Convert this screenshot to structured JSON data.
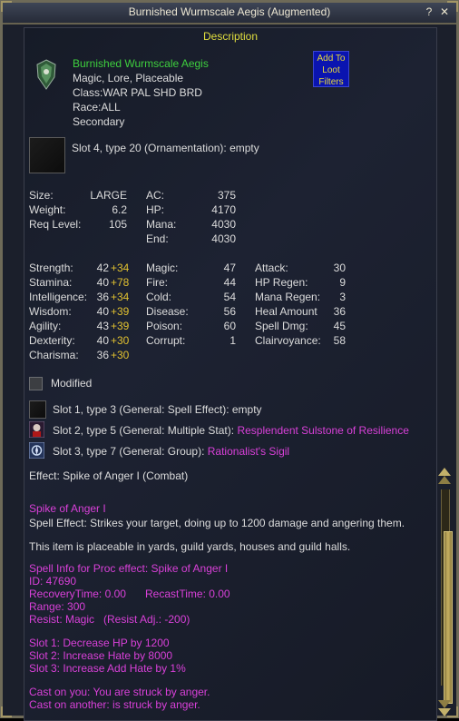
{
  "window": {
    "title": "Burnished Wurmscale Aegis (Augmented)",
    "help_label": "?",
    "close_label": "✕"
  },
  "header": {
    "description_label": "Description",
    "loot_button_label": "Add To\nLoot\nFilters"
  },
  "item": {
    "name": "Burnished Wurmscale Aegis",
    "flags": "Magic, Lore, Placeable",
    "classes": "Class:WAR PAL SHD BRD",
    "races": "Race:ALL",
    "slot": "Secondary",
    "icon": "wurmscale-shield-icon"
  },
  "ornament_slot": "Slot 4, type 20 (Ornamentation): empty",
  "basic_stats": [
    {
      "label": "Size:",
      "value": "LARGE"
    },
    {
      "label": "Weight:",
      "value": "6.2"
    },
    {
      "label": "Req Level:",
      "value": "105"
    }
  ],
  "defense_stats": [
    {
      "label": "AC:",
      "value": "375"
    },
    {
      "label": "HP:",
      "value": "4170"
    },
    {
      "label": "Mana:",
      "value": "4030"
    },
    {
      "label": "End:",
      "value": "4030"
    }
  ],
  "attributes": [
    {
      "label": "Strength:",
      "value": "42",
      "bonus": "+34"
    },
    {
      "label": "Stamina:",
      "value": "40",
      "bonus": "+78"
    },
    {
      "label": "Intelligence:",
      "value": "36",
      "bonus": "+34"
    },
    {
      "label": "Wisdom:",
      "value": "40",
      "bonus": "+39"
    },
    {
      "label": "Agility:",
      "value": "43",
      "bonus": "+39"
    },
    {
      "label": "Dexterity:",
      "value": "40",
      "bonus": "+30"
    },
    {
      "label": "Charisma:",
      "value": "36",
      "bonus": "+30"
    }
  ],
  "resists": [
    {
      "label": "Magic:",
      "value": "47"
    },
    {
      "label": "Fire:",
      "value": "44"
    },
    {
      "label": "Cold:",
      "value": "54"
    },
    {
      "label": "Disease:",
      "value": "56"
    },
    {
      "label": "Poison:",
      "value": "60"
    },
    {
      "label": "Corrupt:",
      "value": "1"
    }
  ],
  "mods": [
    {
      "label": "Attack:",
      "value": "30"
    },
    {
      "label": "HP Regen:",
      "value": "9"
    },
    {
      "label": "Mana Regen:",
      "value": "3"
    },
    {
      "label": "Heal Amount",
      "value": "36"
    },
    {
      "label": "Spell Dmg:",
      "value": "45"
    },
    {
      "label": "Clairvoyance:",
      "value": "58"
    }
  ],
  "modified_label": "Modified",
  "aug_slots": [
    {
      "text": "Slot 1, type 3 (General: Spell Effect): empty",
      "link": "",
      "icon": "empty-slot-icon"
    },
    {
      "text": "Slot 2, type 5 (General: Multiple Stat): ",
      "link": "Resplendent Sulstone of Resilience",
      "icon": "sulstone-icon"
    },
    {
      "text": "Slot 3, type 7 (General: Group): ",
      "link": "Rationalist's Sigil",
      "icon": "sigil-icon"
    }
  ],
  "effect_line": "Effect: Spike of Anger I (Combat)",
  "spell": {
    "name": "Spike of Anger I",
    "effect": "Spell Effect: Strikes your target, doing up to 1200 damage and angering them.",
    "placeable": "This item is placeable in yards, guild yards, houses and guild halls.",
    "info_title": "Spell Info for Proc effect: Spike of Anger I",
    "id": "ID: 47690",
    "recovery": "RecoveryTime: 0.00",
    "recast": "RecastTime: 0.00",
    "range": "Range: 300",
    "resist": "Resist: Magic   (Resist Adj.: -200)",
    "slots": [
      "Slot 1: Decrease HP by 1200",
      "Slot 2: Increase Hate by 8000",
      "Slot 3: Increase Add Hate by 1%"
    ],
    "cast_you": "Cast on you: You are struck by anger.",
    "cast_other": "Cast on another: is struck by anger."
  },
  "colors": {
    "name_green": "#3ecf3e",
    "link_magenta": "#d840d8",
    "bonus_yellow": "#e0c030",
    "header_yellow": "#e1de3e"
  }
}
